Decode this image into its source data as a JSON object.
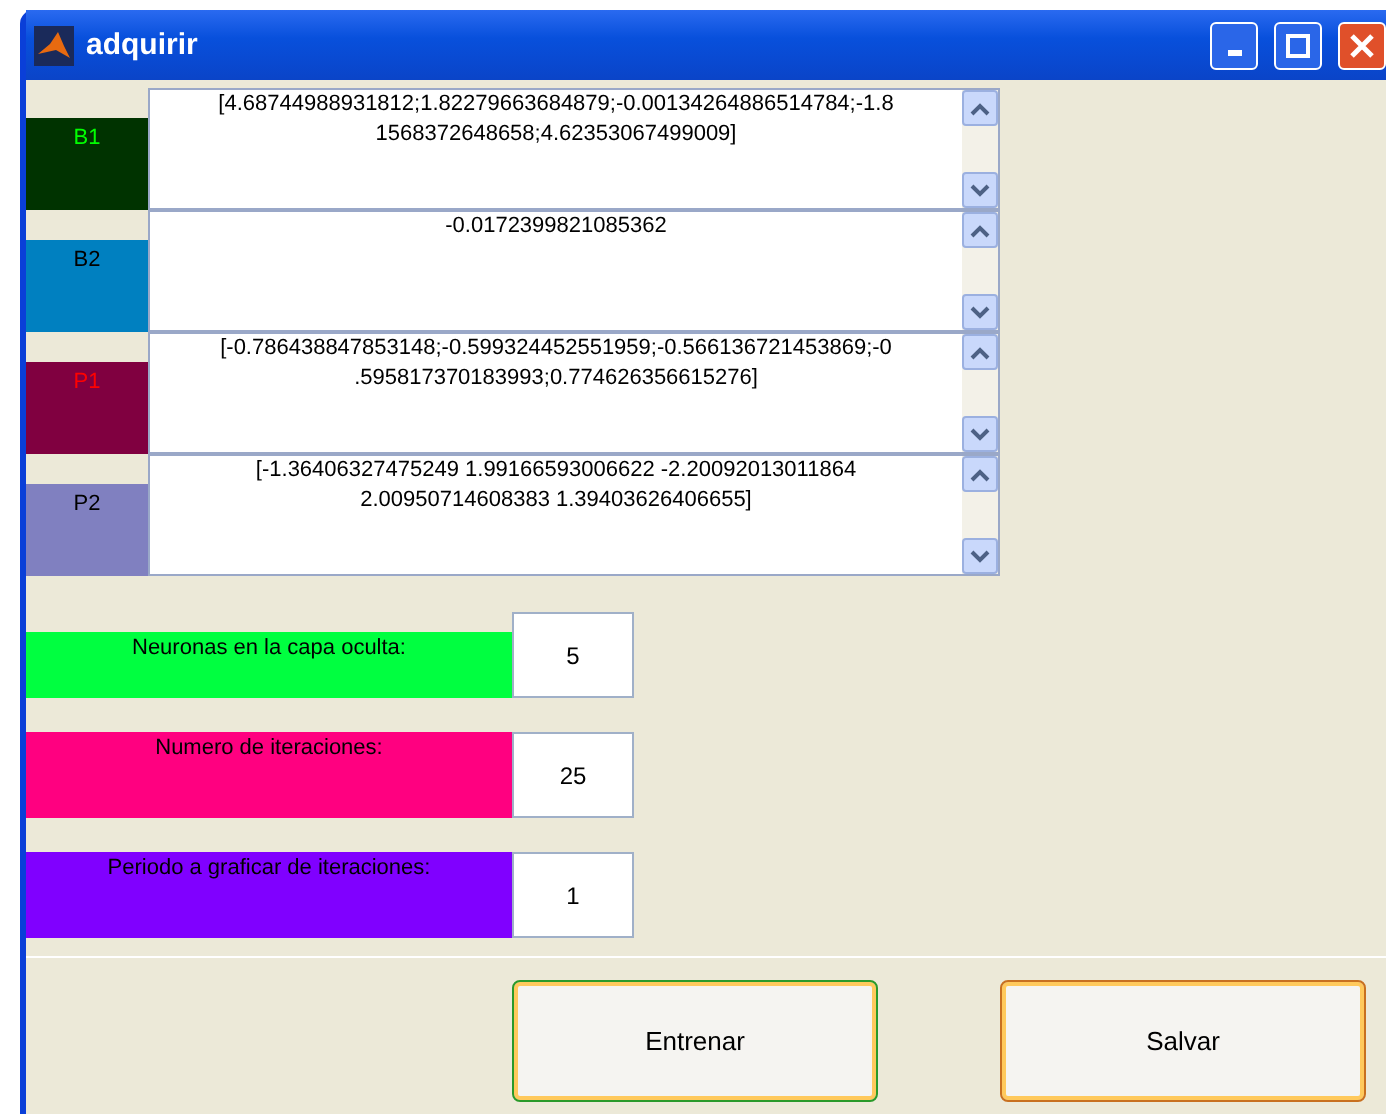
{
  "window": {
    "title": "adquirir"
  },
  "matrices": [
    {
      "label": {
        "text": "B1",
        "color": "#00ff00"
      },
      "color": "#003300",
      "value": "[4.68744988931812;1.82279663684879;-0.00134264886514784;-1.8\n1568372648658;4.62353067499009]"
    },
    {
      "label": {
        "text": "B2",
        "color": "#000000"
      },
      "color": "#0080c0",
      "value": "-0.0172399821085362"
    },
    {
      "label": {
        "text": "P1",
        "color": "#ff0000"
      },
      "color": "#800040",
      "value": "[-0.786438847853148;-0.599324452551959;-0.566136721453869;-0\n.595817370183993;0.774626356615276]"
    },
    {
      "label": {
        "text": "P2",
        "color": "#000000"
      },
      "color": "#8080c0",
      "value": "[-1.36406327475249 1.99166593006622 -2.20092013011864\n2.00950714608383 1.39403626406655]"
    }
  ],
  "parameters": [
    {
      "label": "Neuronas en la capa oculta:",
      "color": "#00ff40",
      "value": "5"
    },
    {
      "label": "Numero de iteraciones:",
      "color": "#ff0080",
      "value": "25"
    },
    {
      "label": "Periodo a graficar de iteraciones:",
      "color": "#8000ff",
      "value": "1"
    }
  ],
  "buttons": [
    {
      "label": "Entrenar"
    },
    {
      "label": "Salvar"
    }
  ]
}
